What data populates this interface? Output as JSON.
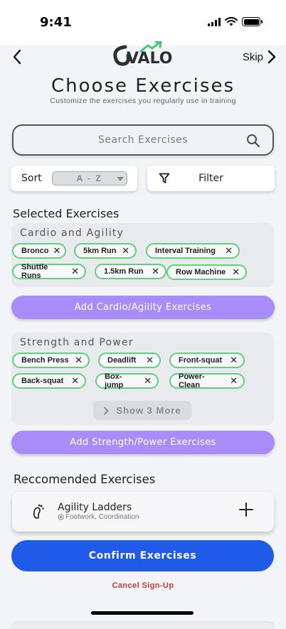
{
  "status": {
    "time": "9:41"
  },
  "nav": {
    "skip_label": "Skip"
  },
  "logo": {
    "text": "VALO"
  },
  "header": {
    "title": "Choose Exercises",
    "subtitle": "Customize the exercises you regularly use in training"
  },
  "search": {
    "placeholder": "Search Exercises"
  },
  "sort": {
    "label": "Sort",
    "value": "A - Z"
  },
  "filter": {
    "label": "Filter"
  },
  "selected": {
    "title": "Selected Exercises",
    "cardio": {
      "title": "Cardio and Agility",
      "chips": [
        "Bronco",
        "5km Run",
        "Interval Training",
        "Shuttle Runs",
        "1.5km Run",
        "Row Machine"
      ],
      "add_label": "Add Cardio/Agility Exercises"
    },
    "strength": {
      "title": "Strength and Power",
      "chips": [
        "Bench Press",
        "Deadlift",
        "Front-squat",
        "Back-squat",
        "Box-jump",
        "Power-Clean"
      ],
      "show_more_label": "Show 3 More",
      "add_label": "Add Strength/Power Exercises"
    }
  },
  "recommended": {
    "title": "Reccomended Exercises",
    "items": [
      {
        "name": "Agility Ladders",
        "tags": "Footwork, Coordination"
      }
    ]
  },
  "actions": {
    "confirm_label": "Confirm Exercises",
    "cancel_label": "Cancel Sign-Up"
  },
  "colors": {
    "chip_border": "#5fd17a",
    "add_button": "#a98cf7",
    "confirm_button": "#1f5be8",
    "cancel_text": "#c13a3a"
  }
}
